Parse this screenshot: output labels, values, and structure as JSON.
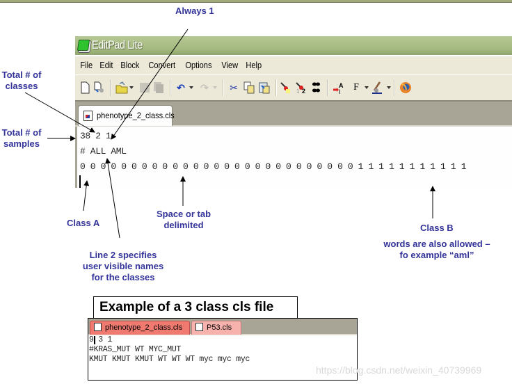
{
  "annotations": {
    "always_one": "Always 1",
    "total_classes": [
      "Total # of",
      "classes"
    ],
    "total_samples": [
      "Total # of",
      "samples"
    ],
    "class_a": "Class A",
    "space_tab": [
      "Space or tab",
      "delimited"
    ],
    "line2": [
      "Line 2 specifies",
      "user visible names",
      "for the classes"
    ],
    "class_b": "Class B",
    "words_allowed": [
      "words are also allowed –",
      "fo example “aml”"
    ]
  },
  "editpad": {
    "title": "EditPad Lite",
    "menu": [
      "File",
      "Edit",
      "Block",
      "Convert",
      "Options",
      "View",
      "Help"
    ],
    "toolbar_icons": [
      "new-file",
      "new-from-template",
      "open-folder",
      "save",
      "save-all",
      "undo",
      "redo",
      "cut",
      "copy",
      "paste",
      "find",
      "find-next",
      "find-replace",
      "insert-text",
      "font",
      "highlight-color",
      "firefox-preview"
    ],
    "tab": "phenotype_2_class.cls",
    "lines": [
      "38 2 1",
      "# ALL AML",
      "0 0 0 0 0 0 0 0 0 0 0 0 0 0 0 0 0 0 0 0 0 0 0 0 0 0 0 1 1 1 1 1 1 1 1 1 1 1"
    ]
  },
  "example": {
    "heading": "Example of a 3 class cls file",
    "tabs": [
      "phenotype_2_class.cls",
      "P53.cls"
    ],
    "tab_colors": [
      "#f07a70",
      "#f7b2ad"
    ],
    "lines": [
      "9 3 1",
      "#KRAS_MUT WT MYC_MUT",
      "KMUT KMUT KMUT WT WT WT myc myc myc"
    ]
  },
  "watermark": "https://blog.csdn.net/weixin_40739969"
}
